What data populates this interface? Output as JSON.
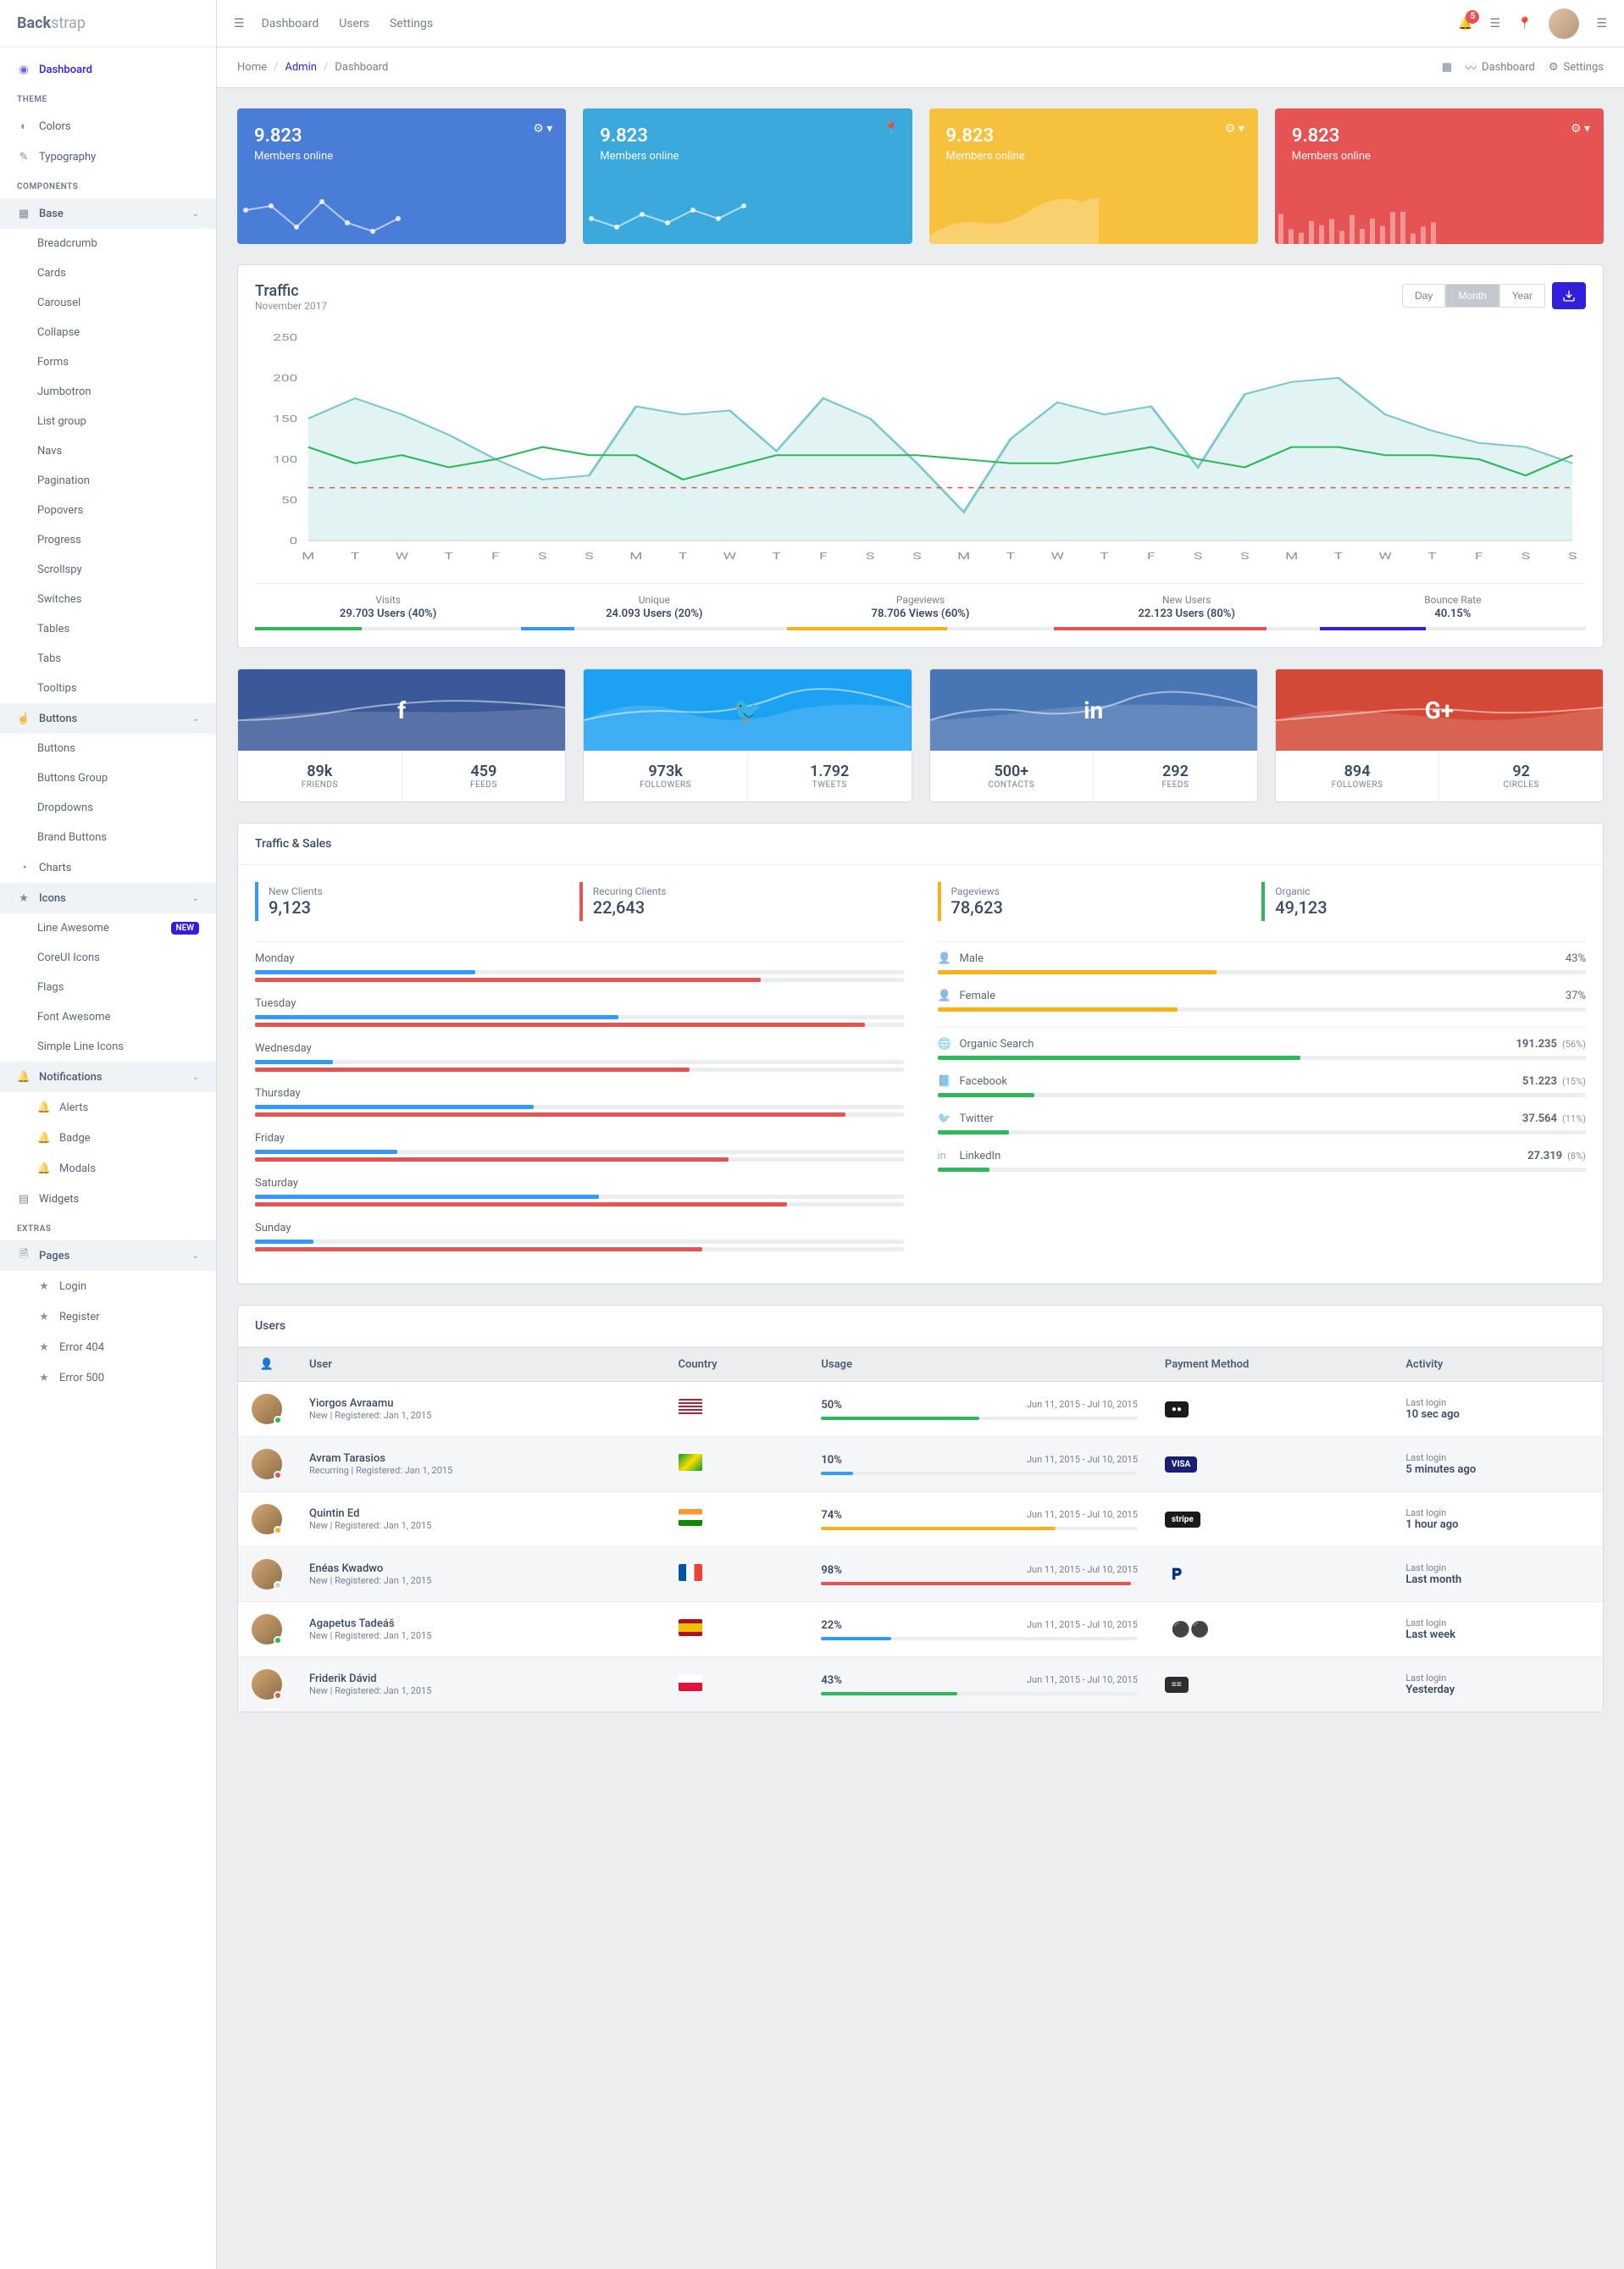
{
  "brand": {
    "prefix": "Back",
    "suffix": "strap"
  },
  "header": {
    "nav": [
      "Dashboard",
      "Users",
      "Settings"
    ],
    "notif_count": "5"
  },
  "breadcrumb": [
    "Home",
    "Admin",
    "Dashboard"
  ],
  "subheader_links": [
    {
      "icon": "speedometer",
      "label": "Dashboard"
    },
    {
      "icon": "gear",
      "label": "Settings"
    }
  ],
  "sidebar": {
    "dashboard": "Dashboard",
    "theme_title": "THEME",
    "colors": "Colors",
    "typography": "Typography",
    "components_title": "COMPONENTS",
    "base": "Base",
    "base_items": [
      "Breadcrumb",
      "Cards",
      "Carousel",
      "Collapse",
      "Forms",
      "Jumbotron",
      "List group",
      "Navs",
      "Pagination",
      "Popovers",
      "Progress",
      "Scrollspy",
      "Switches",
      "Tables",
      "Tabs",
      "Tooltips"
    ],
    "buttons": "Buttons",
    "buttons_items": [
      "Buttons",
      "Buttons Group",
      "Dropdowns",
      "Brand Buttons"
    ],
    "charts": "Charts",
    "icons": "Icons",
    "icons_items": [
      {
        "label": "Line Awesome",
        "badge": "NEW"
      },
      {
        "label": "CoreUI Icons"
      },
      {
        "label": "Flags"
      },
      {
        "label": "Font Awesome"
      },
      {
        "label": "Simple Line Icons"
      }
    ],
    "notifications": "Notifications",
    "notif_items": [
      "Alerts",
      "Badge",
      "Modals"
    ],
    "widgets": "Widgets",
    "extras_title": "EXTRAS",
    "pages": "Pages",
    "pages_items": [
      "Login",
      "Register",
      "Error 404",
      "Error 500"
    ]
  },
  "stat_cards": [
    {
      "value": "9.823",
      "label": "Members online",
      "color": "primary"
    },
    {
      "value": "9.823",
      "label": "Members online",
      "color": "info"
    },
    {
      "value": "9.823",
      "label": "Members online",
      "color": "warning"
    },
    {
      "value": "9.823",
      "label": "Members online",
      "color": "danger"
    }
  ],
  "traffic": {
    "title": "Traffic",
    "subtitle": "November 2017",
    "periods": [
      "Day",
      "Month",
      "Year"
    ],
    "active_period": "Month",
    "footer": [
      {
        "label": "Visits",
        "value": "29.703 Users (40%)",
        "color": "#2eb85c",
        "width": "40%"
      },
      {
        "label": "Unique",
        "value": "24.093 Users (20%)",
        "color": "#3399ff",
        "width": "20%"
      },
      {
        "label": "Pageviews",
        "value": "78.706 Views (60%)",
        "color": "#f9b115",
        "width": "60%"
      },
      {
        "label": "New Users",
        "value": "22.123 Users (80%)",
        "color": "#e55353",
        "width": "80%"
      },
      {
        "label": "Bounce Rate",
        "value": "40.15%",
        "color": "#321fdb",
        "width": "40%"
      }
    ]
  },
  "social": [
    {
      "net": "fb",
      "icon": "f",
      "v1": "89k",
      "l1": "FRIENDS",
      "v2": "459",
      "l2": "FEEDS"
    },
    {
      "net": "tw",
      "icon": "🐦",
      "v1": "973k",
      "l1": "FOLLOWERS",
      "v2": "1.792",
      "l2": "TWEETS"
    },
    {
      "net": "li",
      "icon": "in",
      "v1": "500+",
      "l1": "CONTACTS",
      "v2": "292",
      "l2": "FEEDS"
    },
    {
      "net": "gp",
      "icon": "G+",
      "v1": "894",
      "l1": "FOLLOWERS",
      "v2": "92",
      "l2": "CIRCLES"
    }
  ],
  "ts": {
    "title": "Traffic & Sales",
    "callouts_left": [
      {
        "label": "New Clients",
        "value": "9,123",
        "cls": "co-info"
      },
      {
        "label": "Recuring Clients",
        "value": "22,643",
        "cls": "co-danger"
      }
    ],
    "callouts_right": [
      {
        "label": "Pageviews",
        "value": "78,623",
        "cls": "co-warning"
      },
      {
        "label": "Organic",
        "value": "49,123",
        "cls": "co-success"
      }
    ],
    "days": [
      {
        "label": "Monday",
        "a": 34,
        "b": 78
      },
      {
        "label": "Tuesday",
        "a": 56,
        "b": 94
      },
      {
        "label": "Wednesday",
        "a": 12,
        "b": 67
      },
      {
        "label": "Thursday",
        "a": 43,
        "b": 91
      },
      {
        "label": "Friday",
        "a": 22,
        "b": 73
      },
      {
        "label": "Saturday",
        "a": 53,
        "b": 82
      },
      {
        "label": "Sunday",
        "a": 9,
        "b": 69
      }
    ],
    "gender": [
      {
        "label": "Male",
        "pct": "43%",
        "w": 43
      },
      {
        "label": "Female",
        "pct": "37%",
        "w": 37
      }
    ],
    "sources": [
      {
        "label": "Organic Search",
        "value": "191.235",
        "pct": "(56%)",
        "w": 56
      },
      {
        "label": "Facebook",
        "value": "51.223",
        "pct": "(15%)",
        "w": 15
      },
      {
        "label": "Twitter",
        "value": "37.564",
        "pct": "(11%)",
        "w": 11
      },
      {
        "label": "LinkedIn",
        "value": "27.319",
        "pct": "(8%)",
        "w": 8
      }
    ]
  },
  "users": {
    "title": "Users",
    "headers": [
      "",
      "User",
      "Country",
      "Usage",
      "Payment Method",
      "Activity"
    ],
    "rows": [
      {
        "name": "Yiorgos Avraamu",
        "meta": "New | Registered: Jan 1, 2015",
        "status": "success",
        "flag": "us",
        "flag_colors": "linear-gradient(#b22234 10%,#fff 10% 20%,#b22234 20% 30%,#fff 30% 40%,#b22234 40% 50%,#fff 50% 60%,#b22234 60% 70%,#fff 70% 80%,#b22234 80% 90%,#fff 90%)",
        "usage": "50%",
        "ucolor": "#2eb85c",
        "uw": 50,
        "date": "Jun 11, 2015 - Jul 10, 2015",
        "pay": "mastercard",
        "pay_style": "background:#1a1a1a;color:#fff",
        "pay_text": "●●",
        "last": "10 sec ago"
      },
      {
        "name": "Avram Tarasios",
        "meta": "Recurring | Registered: Jan 1, 2015",
        "status": "danger",
        "flag": "br",
        "flag_colors": "linear-gradient(135deg,#009b3a,#fedf00,#009b3a)",
        "usage": "10%",
        "ucolor": "#3399ff",
        "uw": 10,
        "date": "Jun 11, 2015 - Jul 10, 2015",
        "pay": "visa",
        "pay_style": "background:#1a1f71;color:#fff",
        "pay_text": "VISA",
        "last": "5 minutes ago"
      },
      {
        "name": "Quintin Ed",
        "meta": "New | Registered: Jan 1, 2015",
        "status": "warning",
        "flag": "in",
        "flag_colors": "linear-gradient(#ff9933 33%,#fff 33% 66%,#138808 66%)",
        "usage": "74%",
        "ucolor": "#f9b115",
        "uw": 74,
        "date": "Jun 11, 2015 - Jul 10, 2015",
        "pay": "stripe",
        "pay_style": "background:#1a1a1a;color:#fff",
        "pay_text": "stripe",
        "last": "1 hour ago"
      },
      {
        "name": "Enéas Kwadwo",
        "meta": "New | Registered: Jan 1, 2015",
        "status": "secondary",
        "flag": "fr",
        "flag_colors": "linear-gradient(90deg,#0055a4 33%,#fff 33% 66%,#ef4135 66%)",
        "usage": "98%",
        "ucolor": "#e55353",
        "uw": 98,
        "date": "Jun 11, 2015 - Jul 10, 2015",
        "pay": "paypal",
        "pay_style": "background:transparent;color:#003087;font-size:18px",
        "pay_text": "𝐏",
        "last": "Last month"
      },
      {
        "name": "Agapetus Tadeáš",
        "meta": "New | Registered: Jan 1, 2015",
        "status": "success",
        "flag": "es",
        "flag_colors": "linear-gradient(#aa151b 25%,#f1bf00 25% 75%,#aa151b 75%)",
        "usage": "22%",
        "ucolor": "#3399ff",
        "uw": 22,
        "date": "Jun 11, 2015 - Jul 10, 2015",
        "pay": "wallet",
        "pay_style": "background:transparent;color:#000;font-size:18px",
        "pay_text": "⚫⚫",
        "last": "Last week"
      },
      {
        "name": "Friderik Dávid",
        "meta": "New | Registered: Jan 1, 2015",
        "status": "danger",
        "flag": "pl",
        "flag_colors": "linear-gradient(#fff 50%,#dc143c 50%)",
        "usage": "43%",
        "ucolor": "#2eb85c",
        "uw": 43,
        "date": "Jun 11, 2015 - Jul 10, 2015",
        "pay": "amex",
        "pay_style": "background:#2e2e2e;color:#fff",
        "pay_text": "≡≡",
        "last": "Yesterday"
      }
    ],
    "last_login_label": "Last login"
  },
  "chart_data": {
    "traffic_main": {
      "type": "line",
      "ylim": [
        0,
        250
      ],
      "yticks": [
        0,
        50,
        100,
        150,
        200,
        250
      ],
      "x_labels": [
        "M",
        "T",
        "W",
        "T",
        "F",
        "S",
        "S",
        "M",
        "T",
        "W",
        "T",
        "F",
        "S",
        "S",
        "M",
        "T",
        "W",
        "T",
        "F",
        "S",
        "S",
        "M",
        "T",
        "W",
        "T",
        "F",
        "S",
        "S"
      ],
      "series": [
        {
          "name": "area",
          "color": "#c8e6e9",
          "values": [
            150,
            175,
            155,
            130,
            100,
            75,
            80,
            165,
            155,
            160,
            110,
            175,
            150,
            95,
            35,
            125,
            170,
            155,
            165,
            90,
            180,
            195,
            200,
            155,
            135,
            120,
            115,
            95
          ]
        },
        {
          "name": "line",
          "color": "#2eb85c",
          "values": [
            115,
            95,
            105,
            90,
            100,
            115,
            105,
            105,
            75,
            90,
            105,
            105,
            105,
            105,
            100,
            95,
            95,
            105,
            115,
            100,
            90,
            115,
            115,
            105,
            105,
            100,
            80,
            105
          ]
        },
        {
          "name": "dashed_ref",
          "color": "#e55353",
          "values": 65
        }
      ]
    }
  }
}
